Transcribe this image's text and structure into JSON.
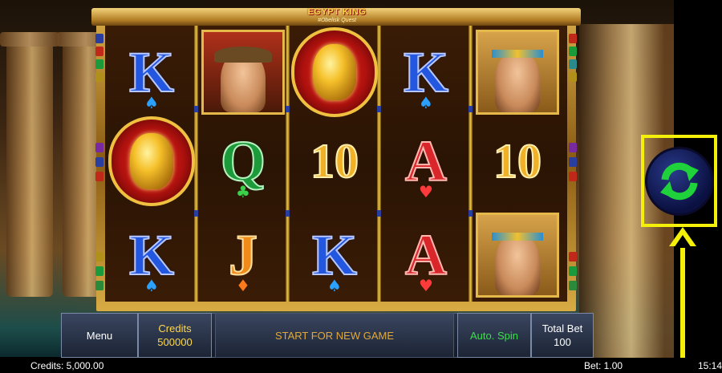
{
  "game": {
    "logo_title": "EGYPT KING",
    "logo_subtitle": "#Obelisk Quest"
  },
  "reels": [
    [
      "K",
      "scarab",
      "K"
    ],
    [
      "explorer",
      "Q",
      "J"
    ],
    [
      "scarab",
      "10",
      "K"
    ],
    [
      "K",
      "A",
      "A"
    ],
    [
      "cleopatra",
      "10",
      "cleopatra"
    ]
  ],
  "controls": {
    "menu_label": "Menu",
    "credits_label": "Credits",
    "credits_value": "500000",
    "start_message": "START FOR NEW GAME",
    "autospin_label": "Auto. Spin",
    "totalbet_label": "Total Bet",
    "totalbet_value": "100",
    "spin_icon": "refresh-icon"
  },
  "status": {
    "credits": "Credits: 5,000.00",
    "bet": "Bet: 1.00",
    "time": "15:14"
  },
  "colors": {
    "highlight": "#f5f00a",
    "spin_arrows": "#1fd13a",
    "credits_text": "#ffd84a",
    "autospin_text": "#3ae04a",
    "start_text": "#e0a83a"
  }
}
